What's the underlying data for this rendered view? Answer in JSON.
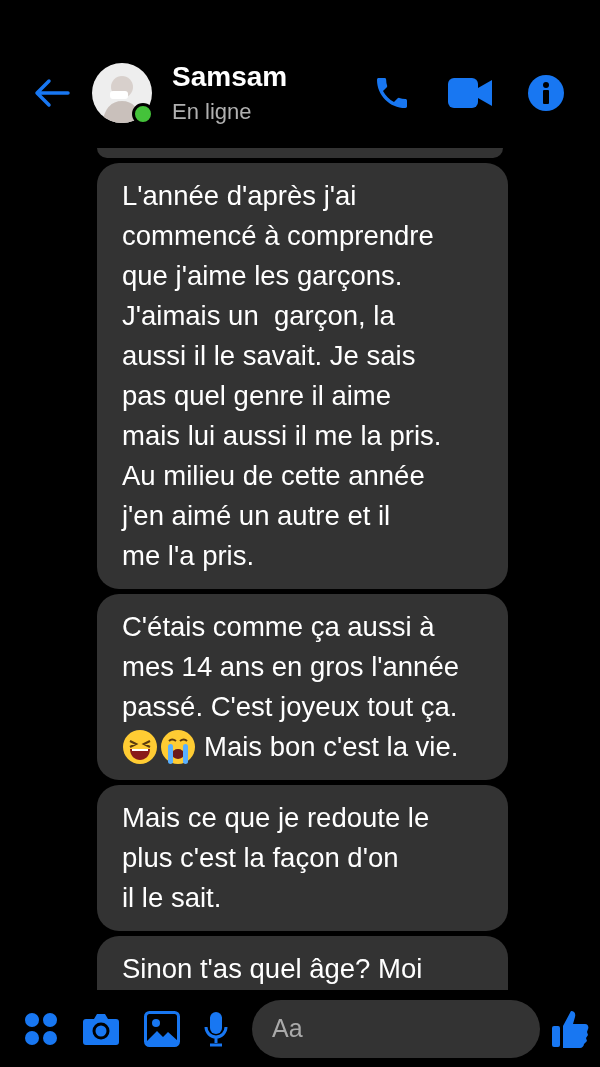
{
  "header": {
    "name": "Samsam",
    "status": "En ligne",
    "online": true
  },
  "messages": [
    {
      "lines": [
        "L'année d'après j'ai",
        "commencé à comprendre",
        "que j'aime les garçons.",
        "J'aimais un  garçon, la",
        "aussi il le savait. Je sais",
        "pas quel genre il aime",
        "mais lui aussi il me la pris.",
        "Au milieu de cette année",
        "j'en aimé un autre et il",
        "me l'a pris."
      ]
    },
    {
      "lines": [
        "C'étais comme ça aussi à",
        "mes 14 ans en gros l'année",
        "passé. C'est joyeux tout ça."
      ],
      "emoji_line": {
        "emojis": [
          {
            "kind": "laughing"
          },
          {
            "kind": "crying"
          }
        ],
        "text": "Mais bon c'est la vie."
      }
    },
    {
      "lines": [
        "Mais ce que je redoute le",
        "plus c'est la façon d'on",
        "il le sait."
      ]
    },
    {
      "lines": [
        "Sinon t'as quel âge? Moi"
      ]
    }
  ],
  "composer": {
    "placeholder": "Aa"
  }
}
